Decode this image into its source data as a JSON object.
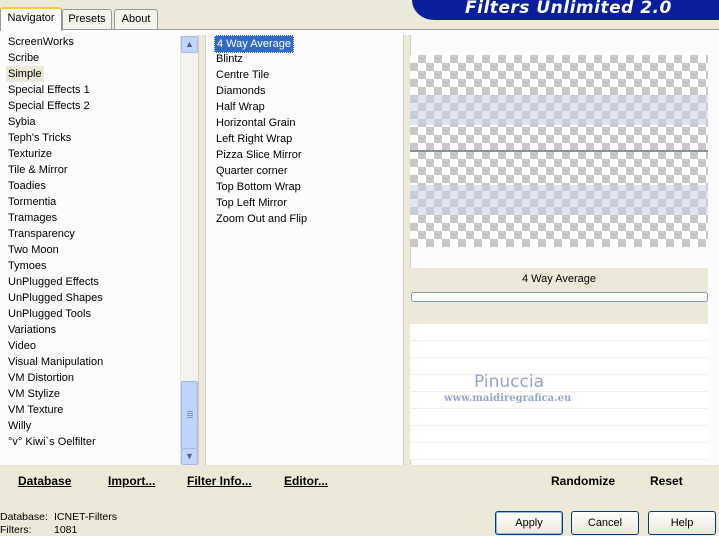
{
  "app": {
    "title": "Filters Unlimited 2.0"
  },
  "tabs": [
    {
      "label": "Navigator",
      "active": true
    },
    {
      "label": "Presets",
      "active": false
    },
    {
      "label": "About",
      "active": false
    }
  ],
  "categories": {
    "selected": "Simple",
    "items": [
      "ScreenWorks",
      "Scribe",
      "Simple",
      "Special Effects 1",
      "Special Effects 2",
      "Sybia",
      "Teph's Tricks",
      "Texturize",
      "Tile & Mirror",
      "Toadies",
      "Tormentia",
      "Tramages",
      "Transparency",
      "Two Moon",
      "Tymoes",
      "UnPlugged Effects",
      "UnPlugged Shapes",
      "UnPlugged Tools",
      "Variations",
      "Video",
      "Visual Manipulation",
      "VM Distortion",
      "VM Stylize",
      "VM Texture",
      "Willy",
      "°v° Kiwi`s Oelfilter"
    ]
  },
  "filters": {
    "selected": "4 Way Average",
    "items": [
      "4 Way Average",
      "Blintz",
      "Centre Tile",
      "Diamonds",
      "Half Wrap",
      "Horizontal Grain",
      "Left Right Wrap",
      "Pizza Slice Mirror",
      "Quarter corner",
      "Top Bottom Wrap",
      "Top Left Mirror",
      "Zoom Out and Flip"
    ]
  },
  "preview": {
    "filter_name": "4 Way Average"
  },
  "watermark": {
    "name": "Pinuccia",
    "url": "www.maidiregrafica.eu"
  },
  "panel_buttons": {
    "database": "Database",
    "import": "Import...",
    "filter_info": "Filter Info...",
    "editor": "Editor...",
    "randomize": "Randomize",
    "reset": "Reset"
  },
  "status": {
    "database_label": "Database:",
    "database_value": "ICNET-Filters",
    "filters_label": "Filters:",
    "filters_value": "1081"
  },
  "dialog_buttons": {
    "apply": "Apply",
    "cancel": "Cancel",
    "help": "Help"
  },
  "colors": {
    "banner": "#0a1e9c",
    "selection": "#316ac5",
    "background": "#ece9d8"
  }
}
